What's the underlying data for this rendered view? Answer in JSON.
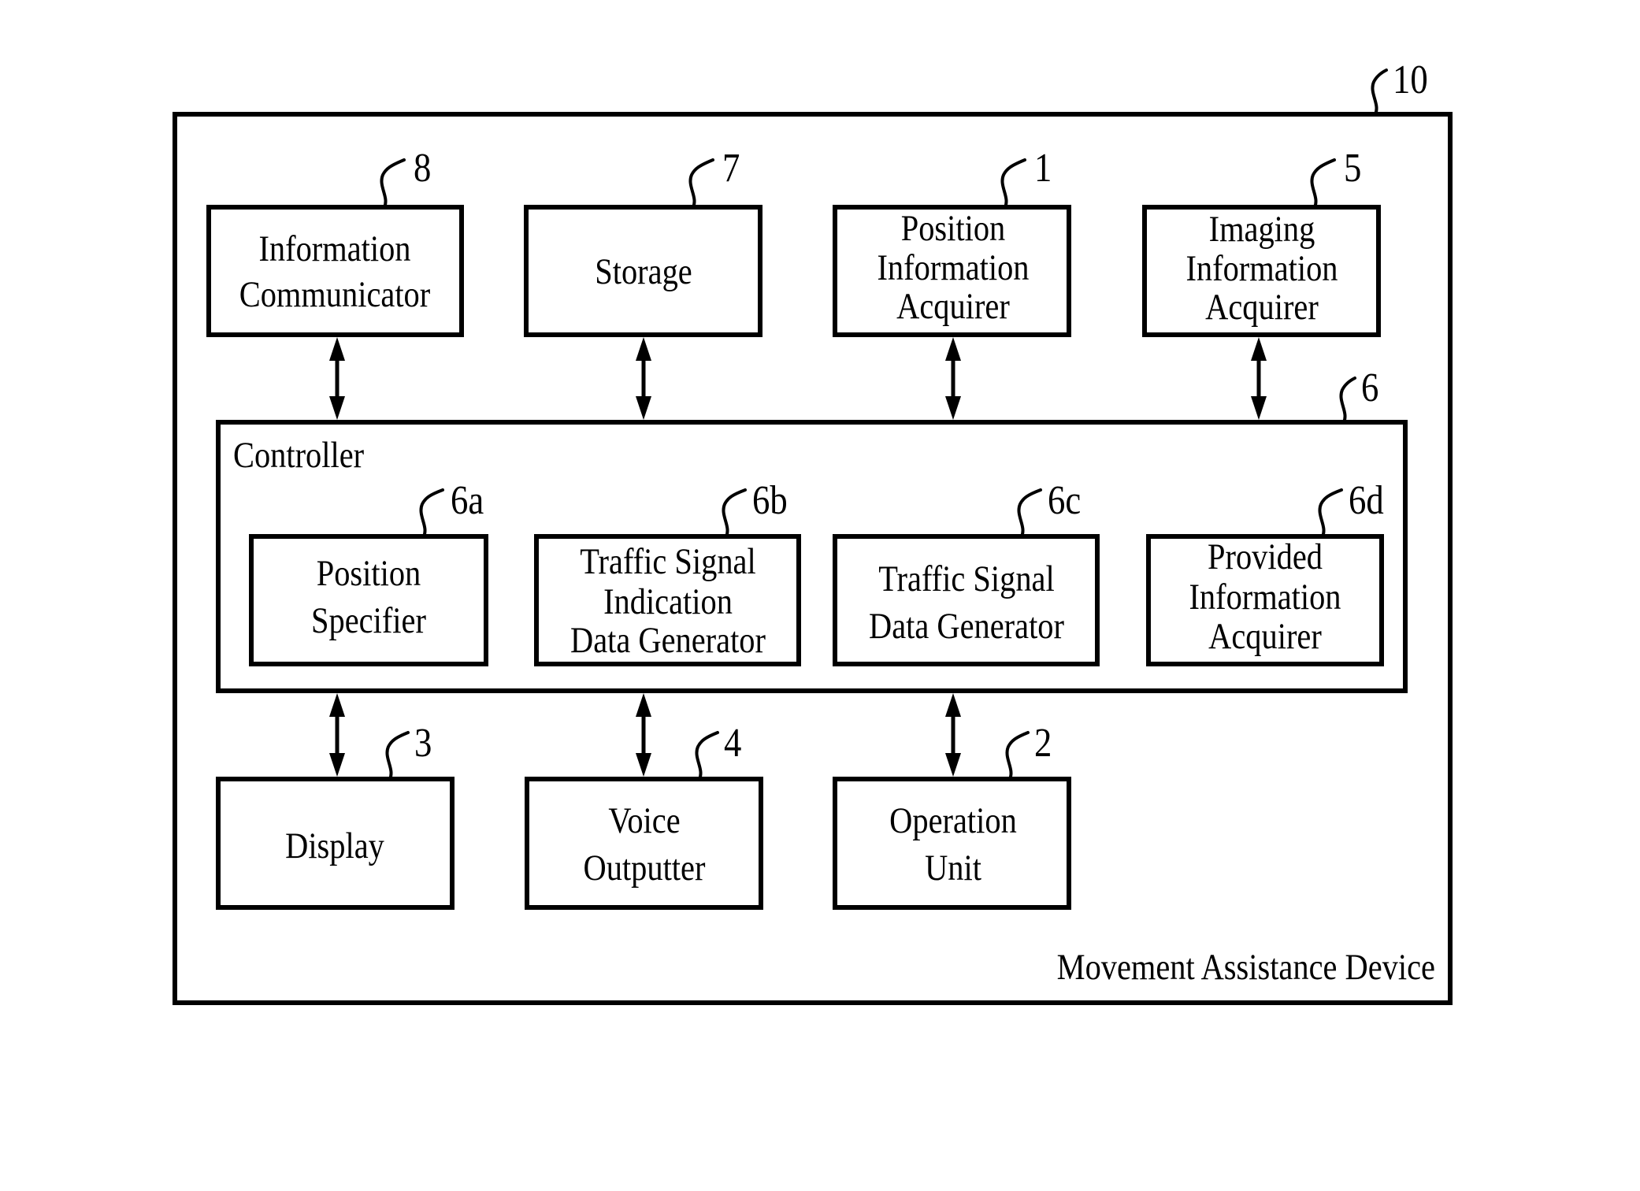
{
  "figure": {
    "device": {
      "ref": "10",
      "label": "Movement Assistance Device"
    },
    "controller": {
      "ref": "6",
      "label": "Controller"
    },
    "top_blocks": [
      {
        "ref": "8",
        "lines": [
          "Information",
          "Communicator"
        ]
      },
      {
        "ref": "7",
        "lines": [
          "Storage"
        ]
      },
      {
        "ref": "1",
        "lines": [
          "Position",
          "Information",
          "Acquirer"
        ]
      },
      {
        "ref": "5",
        "lines": [
          "Imaging",
          "Information",
          "Acquirer"
        ]
      }
    ],
    "controller_blocks": [
      {
        "ref": "6a",
        "lines": [
          "Position",
          "Specifier"
        ]
      },
      {
        "ref": "6b",
        "lines": [
          "Traffic Signal",
          "Indication",
          "Data Generator"
        ]
      },
      {
        "ref": "6c",
        "lines": [
          "Traffic Signal",
          "Data Generator"
        ]
      },
      {
        "ref": "6d",
        "lines": [
          "Provided",
          "Information",
          "Acquirer"
        ]
      }
    ],
    "bottom_blocks": [
      {
        "ref": "3",
        "lines": [
          "Display"
        ]
      },
      {
        "ref": "4",
        "lines": [
          "Voice",
          "Outputter"
        ]
      },
      {
        "ref": "2",
        "lines": [
          "Operation",
          "Unit"
        ]
      }
    ],
    "connections": [
      {
        "from": "8",
        "to": "6",
        "type": "bidirectional"
      },
      {
        "from": "7",
        "to": "6",
        "type": "bidirectional"
      },
      {
        "from": "1",
        "to": "6",
        "type": "bidirectional"
      },
      {
        "from": "5",
        "to": "6",
        "type": "bidirectional"
      },
      {
        "from": "6",
        "to": "3",
        "type": "bidirectional"
      },
      {
        "from": "6",
        "to": "4",
        "type": "bidirectional"
      },
      {
        "from": "6",
        "to": "2",
        "type": "bidirectional"
      }
    ]
  }
}
